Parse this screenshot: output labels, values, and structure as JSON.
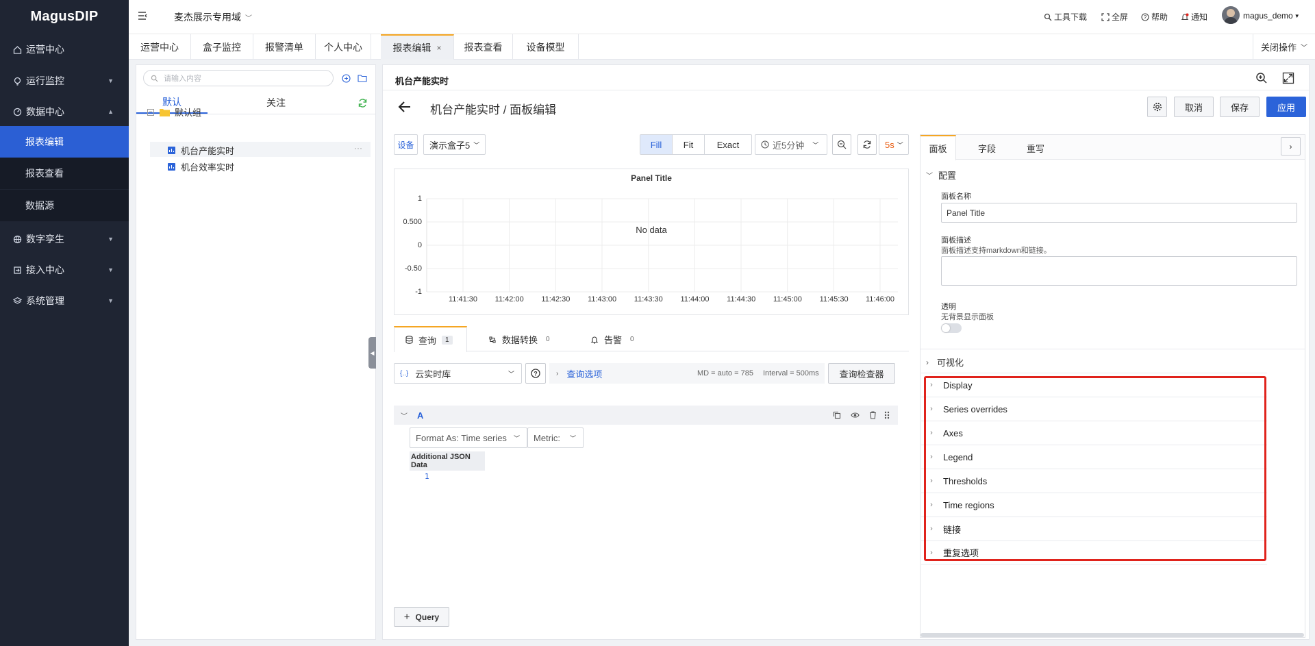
{
  "app": {
    "logo": "MagusDIP"
  },
  "sidebar": {
    "items": [
      {
        "label": "运营中心",
        "icon": "home-icon"
      },
      {
        "label": "运行监控",
        "icon": "bulb-icon"
      },
      {
        "label": "数据中心",
        "icon": "gauge-icon"
      },
      {
        "label": "数字孪生",
        "icon": "globe-icon"
      },
      {
        "label": "接入中心",
        "icon": "login-icon"
      },
      {
        "label": "系统管理",
        "icon": "layers-icon"
      }
    ],
    "subitems": [
      {
        "label": "报表编辑",
        "active": true
      },
      {
        "label": "报表查看"
      },
      {
        "label": "数据源"
      }
    ]
  },
  "topbar": {
    "domain": "麦杰展示专用域",
    "tools": "工具下载",
    "fullscreen": "全屏",
    "help": "帮助",
    "notify": "通知",
    "user": "magus_demo"
  },
  "tabs": {
    "items": [
      "运营中心",
      "盒子监控",
      "报警清单",
      "个人中心",
      "报表编辑",
      "报表查看",
      "设备模型"
    ],
    "active": "报表编辑",
    "close_ops": "关闭操作"
  },
  "tree": {
    "search_placeholder": "请输入内容",
    "tab_default": "默认",
    "tab_follow": "关注",
    "group": "默认组",
    "reports": [
      "机台产能实时",
      "机台效率实时"
    ]
  },
  "editor": {
    "header_title": "机台产能实时",
    "page_title": "机台产能实时 / 面板编辑",
    "cancel": "取消",
    "save": "保存",
    "apply": "应用",
    "device_label": "设备",
    "device_value": "演示盒子5",
    "fill": "Fill",
    "fit": "Fit",
    "exact": "Exact",
    "time_range": "近5分钟",
    "refresh": "5s"
  },
  "chart_data": {
    "type": "line",
    "title": "Panel Title",
    "no_data": "No data",
    "y_ticks": [
      "1",
      "0.500",
      "0",
      "-0.50",
      "-1"
    ],
    "x_ticks": [
      "11:41:30",
      "11:42:00",
      "11:42:30",
      "11:43:00",
      "11:43:30",
      "11:44:00",
      "11:44:30",
      "11:45:00",
      "11:45:30",
      "11:46:00"
    ],
    "ylim": [
      -1,
      1
    ],
    "series": [],
    "grid": true
  },
  "query": {
    "tab_query": "查询",
    "tab_query_count": "1",
    "tab_transform": "数据转换",
    "tab_transform_count": "0",
    "tab_alert": "告警",
    "tab_alert_count": "0",
    "datasource": "云实时库",
    "options_link": "查询选项",
    "md": "MD = auto = 785",
    "interval": "Interval = 500ms",
    "inspector": "查询检查器",
    "ref": "A",
    "format": "Format As: Time series",
    "metric": "Metric:",
    "json_label": "Additional JSON Data",
    "line_no": "1",
    "add_query": "Query"
  },
  "options": {
    "tabs": [
      "面板",
      "字段",
      "重写"
    ],
    "section_config": "配置",
    "name_label": "面板名称",
    "name_value": "Panel Title",
    "desc_label": "面板描述",
    "desc_hint": "面板描述支持markdown和链接。",
    "transparent_label": "透明",
    "transparent_hint": "无背景显示面板",
    "visualization": "可视化",
    "sections": [
      "Display",
      "Series overrides",
      "Axes",
      "Legend",
      "Thresholds",
      "Time regions",
      "链接",
      "重复选项"
    ]
  },
  "colors": {
    "accent": "#2b63d9",
    "highlight_box": "#e0231c",
    "sidebar": "#1f2533"
  }
}
